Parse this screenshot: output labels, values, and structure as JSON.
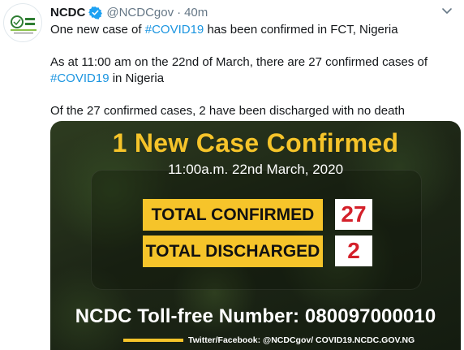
{
  "tweet": {
    "author_name": "NCDC",
    "handle": "@NCDCgov",
    "separator": "·",
    "time": "40m",
    "text_line1_prefix": "One new case of ",
    "text_line1_hashtag": "#COVID19",
    "text_line1_suffix": " has been confirmed in FCT, Nigeria",
    "text_line2_prefix": "As at 11:00 am on the 22nd of March, there are 27 confirmed cases of",
    "text_line2_hashtag": "#COVID19",
    "text_line2_suffix": " in Nigeria",
    "text_line3": "Of the 27 confirmed cases, 2 have been discharged with no death"
  },
  "graphic": {
    "headline": "1 New Case Confirmed",
    "datetime": "11:00a.m. 22nd March, 2020",
    "stats": [
      {
        "label": "TOTAL CONFIRMED",
        "value": "27"
      },
      {
        "label": "TOTAL DISCHARGED",
        "value": "2"
      }
    ],
    "tollfree": "NCDC Toll-free Number: 080097000010",
    "social": "Twitter/Facebook: @NCDCgov/ COVID19.NCDC.GOV.NG"
  },
  "colors": {
    "verified": "#1da1f2",
    "hashtag": "#1b95e0",
    "accent_yellow": "#f6c42a",
    "value_red": "#d4202a"
  },
  "icons": [
    "ncdc-logo-icon",
    "verified-badge-icon",
    "chevron-down-icon"
  ]
}
